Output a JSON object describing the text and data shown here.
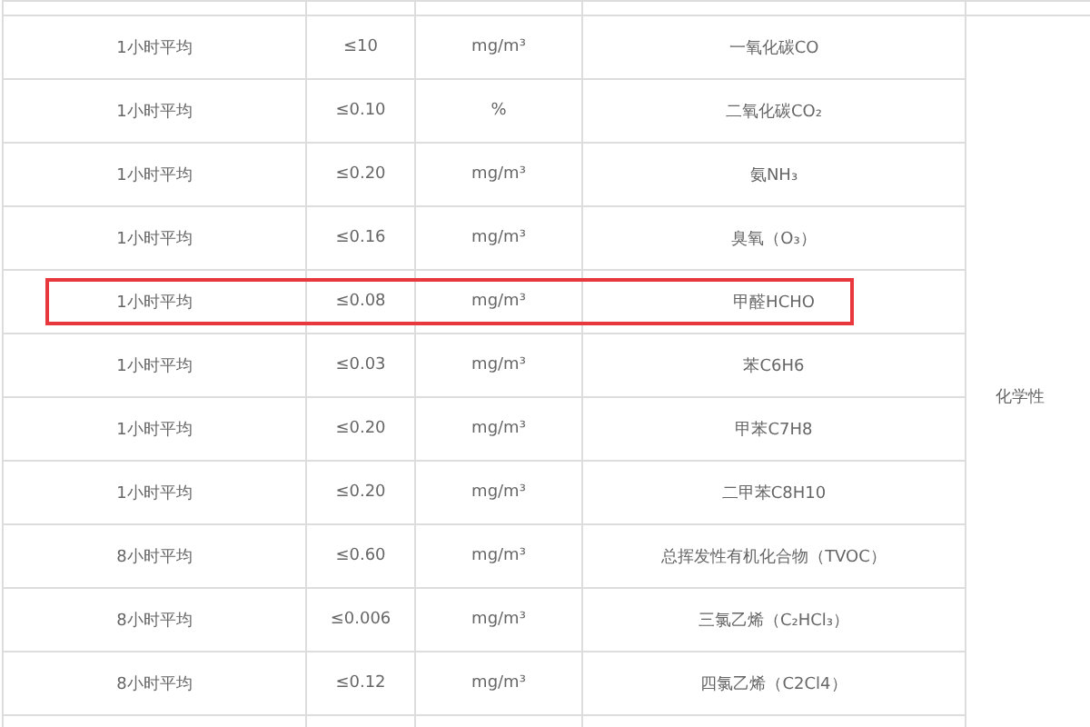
{
  "table": {
    "category": "化学性",
    "rows": [
      {
        "averaging": "1小时平均",
        "limit": "≤10",
        "unit": "mg/m³",
        "parameter": "一氧化碳CO",
        "highlighted": false
      },
      {
        "averaging": "1小时平均",
        "limit": "≤0.10",
        "unit": "%",
        "parameter": "二氧化碳CO₂",
        "highlighted": false
      },
      {
        "averaging": "1小时平均",
        "limit": "≤0.20",
        "unit": "mg/m³",
        "parameter": "氨NH₃",
        "highlighted": false
      },
      {
        "averaging": "1小时平均",
        "limit": "≤0.16",
        "unit": "mg/m³",
        "parameter": "臭氧（O₃）",
        "highlighted": false
      },
      {
        "averaging": "1小时平均",
        "limit": "≤0.08",
        "unit": "mg/m³",
        "parameter": "甲醛HCHO",
        "highlighted": true
      },
      {
        "averaging": "1小时平均",
        "limit": "≤0.03",
        "unit": "mg/m³",
        "parameter": "苯C6H6",
        "highlighted": false
      },
      {
        "averaging": "1小时平均",
        "limit": "≤0.20",
        "unit": "mg/m³",
        "parameter": "甲苯C7H8",
        "highlighted": false
      },
      {
        "averaging": "1小时平均",
        "limit": "≤0.20",
        "unit": "mg/m³",
        "parameter": "二甲苯C8H10",
        "highlighted": false
      },
      {
        "averaging": "8小时平均",
        "limit": "≤0.60",
        "unit": "mg/m³",
        "parameter": "总挥发性有机化合物（TVOC）",
        "highlighted": false
      },
      {
        "averaging": "8小时平均",
        "limit": "≤0.006",
        "unit": "mg/m³",
        "parameter": "三氯乙烯（C₂HCl₃）",
        "highlighted": false
      },
      {
        "averaging": "8小时平均",
        "limit": "≤0.12",
        "unit": "mg/m³",
        "parameter": "四氯乙烯（C2Cl4）",
        "highlighted": false
      }
    ]
  }
}
